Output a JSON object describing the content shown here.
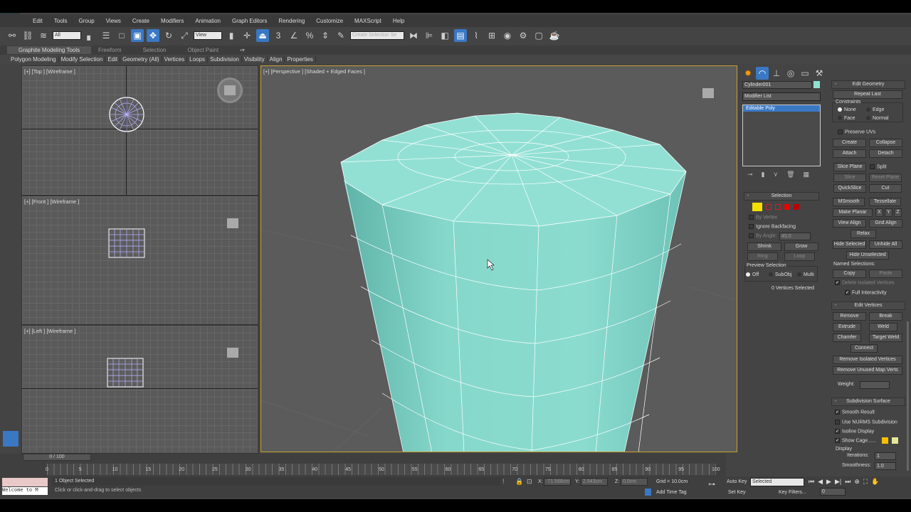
{
  "menu": [
    "Edit",
    "Tools",
    "Group",
    "Views",
    "Create",
    "Modifiers",
    "Animation",
    "Graph Editors",
    "Rendering",
    "Customize",
    "MAXScript",
    "Help"
  ],
  "toolbar": {
    "selection_filter": "All",
    "ref_coord": "View",
    "named_selection": "Create Selection Se",
    "snap_labels": [
      "3",
      "%"
    ]
  },
  "ribbon": {
    "tabs": [
      "Graphite Modeling Tools",
      "Freeform",
      "Selection",
      "Object Paint"
    ],
    "panels": [
      "Polygon Modeling",
      "Modify Selection",
      "Edit",
      "Geometry (All)",
      "Vertices",
      "Loops",
      "Subdivision",
      "Visibility",
      "Align",
      "Properties"
    ]
  },
  "viewports": {
    "top": "[+] [Top ] [Wireframe ]",
    "front": "[+] [Front ] [Wireframe ]",
    "left": "[+] [Left ] [Wireframe ]",
    "perspective": "[+] [Perspective ] [Shaded + Edged Faces ]"
  },
  "command_panel": {
    "object_name": "Cylinder001",
    "object_color": "#8fe0d0",
    "modifier_list": "Modifier List",
    "stack": [
      "Editable Poly"
    ],
    "selection": {
      "title": "Selection",
      "by_vertex": "By Vertex",
      "ignore_backfacing": "Ignore Backfacing",
      "by_angle": "By Angle:",
      "angle": "45.0",
      "shrink": "Shrink",
      "grow": "Grow",
      "ring": "Ring",
      "loop": "Loop",
      "preview": "Preview Selection",
      "off": "Off",
      "subobj": "SubObj",
      "multi": "Multi",
      "status": "0 Vertices Selected"
    },
    "edit_geometry": {
      "title": "Edit Geometry",
      "repeat_last": "Repeat Last",
      "constraints": "Constraints",
      "none": "None",
      "edge": "Edge",
      "face": "Face",
      "normal": "Normal",
      "preserve_uvs": "Preserve UVs",
      "create": "Create",
      "collapse": "Collapse",
      "attach": "Attach",
      "detach": "Detach",
      "slice_plane": "Slice Plane",
      "split": "Split",
      "slice": "Slice",
      "reset_plane": "Reset Plane",
      "quickslice": "QuickSlice",
      "cut": "Cut",
      "msmooth": "MSmooth",
      "tessellate": "Tessellate",
      "make_planar": "Make Planar",
      "x": "X",
      "y": "Y",
      "z": "Z",
      "view_align": "View Align",
      "grid_align": "Grid Align",
      "relax": "Relax",
      "hide_selected": "Hide Selected",
      "unhide_all": "Unhide All",
      "hide_unselected": "Hide Unselected",
      "named_selections": "Named Selections:",
      "copy": "Copy",
      "paste": "Paste",
      "delete_isolated": "Delete Isolated Vertices",
      "full_interactivity": "Full Interactivity"
    },
    "edit_vertices": {
      "title": "Edit Vertices",
      "remove": "Remove",
      "break": "Break",
      "extrude": "Extrude",
      "weld": "Weld",
      "chamfer": "Chamfer",
      "target_weld": "Target Weld",
      "connect": "Connect",
      "remove_isolated": "Remove Isolated Vertices",
      "remove_unused": "Remove Unused Map Verts",
      "weight": "Weight:"
    },
    "subdivision": {
      "title": "Subdivision Surface",
      "smooth_result": "Smooth Result",
      "use_nurms": "Use NURMS Subdivision",
      "isoline": "Isoline Display",
      "show_cage": "Show Cage......",
      "display": "Display",
      "iterations_label": "Iterations:",
      "iterations": "1",
      "smoothness_label": "Smoothness:",
      "smoothness": "1.0"
    }
  },
  "timeline": {
    "frame": "0 / 100",
    "ticks": [
      "0",
      "5",
      "10",
      "15",
      "20",
      "25",
      "30",
      "35",
      "40",
      "45",
      "50",
      "55",
      "60",
      "65",
      "70",
      "75",
      "80",
      "85",
      "90",
      "95",
      "100"
    ]
  },
  "status": {
    "selected": "1 Object Selected",
    "prompt": "Click or click-and-drag to select objects",
    "x_label": "X:",
    "x": "-71.568cm",
    "y_label": "Y:",
    "y": "2.943cm",
    "z_label": "Z:",
    "z": "0.0cm",
    "grid": "Grid = 10.0cm",
    "add_time_tag": "Add Time Tag",
    "auto_key": "Auto Key",
    "set_key": "Set Key",
    "key_mode": "Selected",
    "key_filters": "Key Filters...",
    "current_frame": "0",
    "maxscript": "Welcome to M"
  }
}
